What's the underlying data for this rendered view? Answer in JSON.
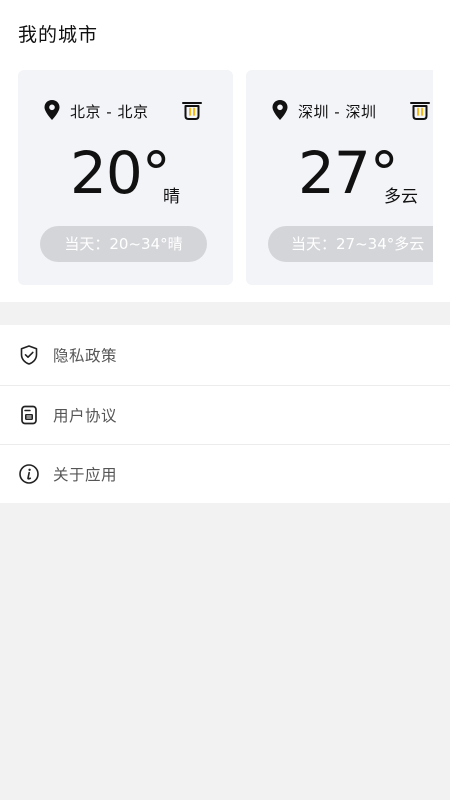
{
  "page_title": "我的城市",
  "cities": [
    {
      "name": "北京 - 北京",
      "temperature": "20°",
      "condition": "晴",
      "range": "当天：20~34°晴"
    },
    {
      "name": "深圳 - 深圳",
      "temperature": "27°",
      "condition": "多云",
      "range": "当天：27~34°多云"
    }
  ],
  "menu": [
    {
      "label": "隐私政策",
      "icon": "shield-check-icon"
    },
    {
      "label": "用户协议",
      "icon": "document-icon"
    },
    {
      "label": "关于应用",
      "icon": "info-icon"
    }
  ],
  "colors": {
    "card_bg": "#f3f4f8",
    "pill_bg": "#d4d5d9",
    "delete_accent": "#f5b400",
    "page_bg": "#f2f2f3"
  }
}
